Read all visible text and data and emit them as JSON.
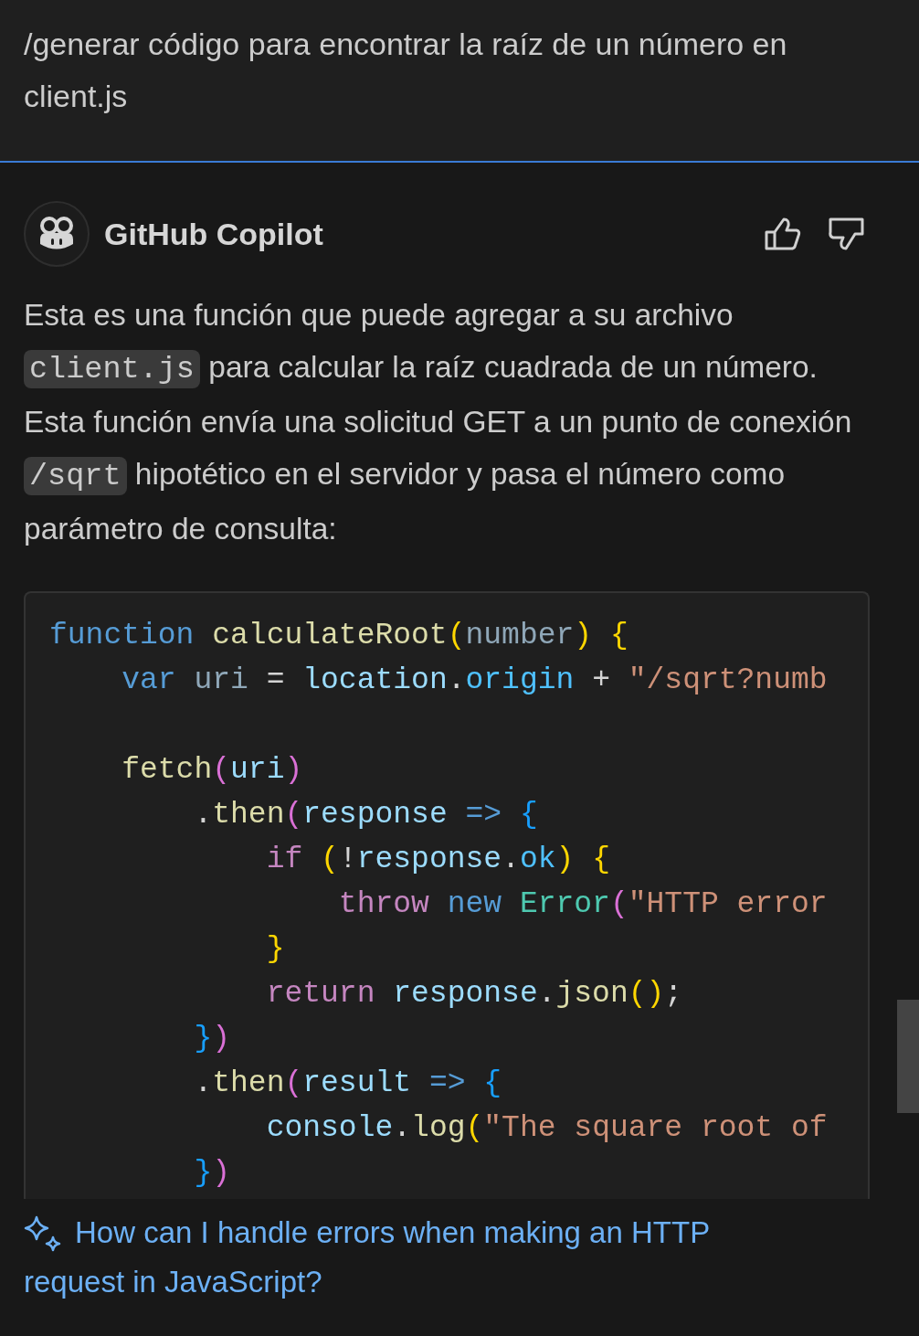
{
  "prompt": "/generar código para encontrar la raíz de un número en client.js",
  "response": {
    "author": "GitHub Copilot",
    "paragraph": [
      {
        "kind": "text",
        "text": "Esta es una función que puede agregar a su archivo "
      },
      {
        "kind": "code",
        "text": "client.js"
      },
      {
        "kind": "text",
        "text": " para calcular la raíz cuadrada de un número. Esta función envía una solicitud GET a un punto de conexión "
      },
      {
        "kind": "code",
        "text": "/sqrt"
      },
      {
        "kind": "text",
        "text": " hipotético en el servidor y pasa el número como parámetro de consulta:"
      }
    ],
    "code_lines": [
      {
        "kind": "code",
        "tokens": [
          {
            "kind": "keyword",
            "text": "function "
          },
          {
            "kind": "func",
            "text": "calculateRoot"
          },
          {
            "kind": "bracket1",
            "text": "("
          },
          {
            "kind": "param",
            "text": "number"
          },
          {
            "kind": "bracket1",
            "text": ") {"
          }
        ]
      },
      {
        "kind": "code",
        "tokens": [
          {
            "kind": "keyword",
            "text": "    var "
          },
          {
            "kind": "param",
            "text": "uri "
          },
          {
            "kind": "plain",
            "text": "= "
          },
          {
            "kind": "variable",
            "text": "location"
          },
          {
            "kind": "plain",
            "text": "."
          },
          {
            "kind": "property",
            "text": "origin "
          },
          {
            "kind": "plain",
            "text": "+ "
          },
          {
            "kind": "string",
            "text": "\"/sqrt?numb"
          }
        ]
      },
      {
        "kind": "blank"
      },
      {
        "kind": "code",
        "tokens": [
          {
            "kind": "func",
            "text": "    fetch"
          },
          {
            "kind": "bracket2",
            "text": "("
          },
          {
            "kind": "variable",
            "text": "uri"
          },
          {
            "kind": "bracket2",
            "text": ")"
          }
        ]
      },
      {
        "kind": "code",
        "tokens": [
          {
            "kind": "plain",
            "text": "        ."
          },
          {
            "kind": "func",
            "text": "then"
          },
          {
            "kind": "bracket2",
            "text": "("
          },
          {
            "kind": "variable",
            "text": "response "
          },
          {
            "kind": "keyword",
            "text": "=> "
          },
          {
            "kind": "bracket3",
            "text": "{"
          }
        ]
      },
      {
        "kind": "code",
        "tokens": [
          {
            "kind": "control",
            "text": "            if "
          },
          {
            "kind": "bracket1",
            "text": "("
          },
          {
            "kind": "plain",
            "text": "!"
          },
          {
            "kind": "variable",
            "text": "response"
          },
          {
            "kind": "plain",
            "text": "."
          },
          {
            "kind": "property",
            "text": "ok"
          },
          {
            "kind": "bracket1",
            "text": ") {"
          }
        ]
      },
      {
        "kind": "code",
        "tokens": [
          {
            "kind": "control",
            "text": "                throw "
          },
          {
            "kind": "keyword",
            "text": "new "
          },
          {
            "kind": "type",
            "text": "Error"
          },
          {
            "kind": "bracket2",
            "text": "("
          },
          {
            "kind": "string",
            "text": "\"HTTP error"
          }
        ]
      },
      {
        "kind": "code",
        "tokens": [
          {
            "kind": "bracket1",
            "text": "            }"
          }
        ]
      },
      {
        "kind": "code",
        "tokens": [
          {
            "kind": "control",
            "text": "            return "
          },
          {
            "kind": "variable",
            "text": "response"
          },
          {
            "kind": "plain",
            "text": "."
          },
          {
            "kind": "func",
            "text": "json"
          },
          {
            "kind": "bracket1",
            "text": "()"
          },
          {
            "kind": "plain",
            "text": ";"
          }
        ]
      },
      {
        "kind": "code",
        "tokens": [
          {
            "kind": "bracket3",
            "text": "        }"
          },
          {
            "kind": "bracket2",
            "text": ")"
          }
        ]
      },
      {
        "kind": "code",
        "tokens": [
          {
            "kind": "plain",
            "text": "        ."
          },
          {
            "kind": "func",
            "text": "then"
          },
          {
            "kind": "bracket2",
            "text": "("
          },
          {
            "kind": "variable",
            "text": "result "
          },
          {
            "kind": "keyword",
            "text": "=> "
          },
          {
            "kind": "bracket3",
            "text": "{"
          }
        ]
      },
      {
        "kind": "code",
        "tokens": [
          {
            "kind": "variable",
            "text": "            console"
          },
          {
            "kind": "plain",
            "text": "."
          },
          {
            "kind": "func",
            "text": "log"
          },
          {
            "kind": "bracket1",
            "text": "("
          },
          {
            "kind": "string",
            "text": "\"The square root of"
          }
        ]
      },
      {
        "kind": "code",
        "tokens": [
          {
            "kind": "bracket3",
            "text": "        }"
          },
          {
            "kind": "bracket2",
            "text": ")"
          }
        ]
      }
    ]
  },
  "suggestion": "How can I handle errors when making an HTTP request in JavaScript?"
}
